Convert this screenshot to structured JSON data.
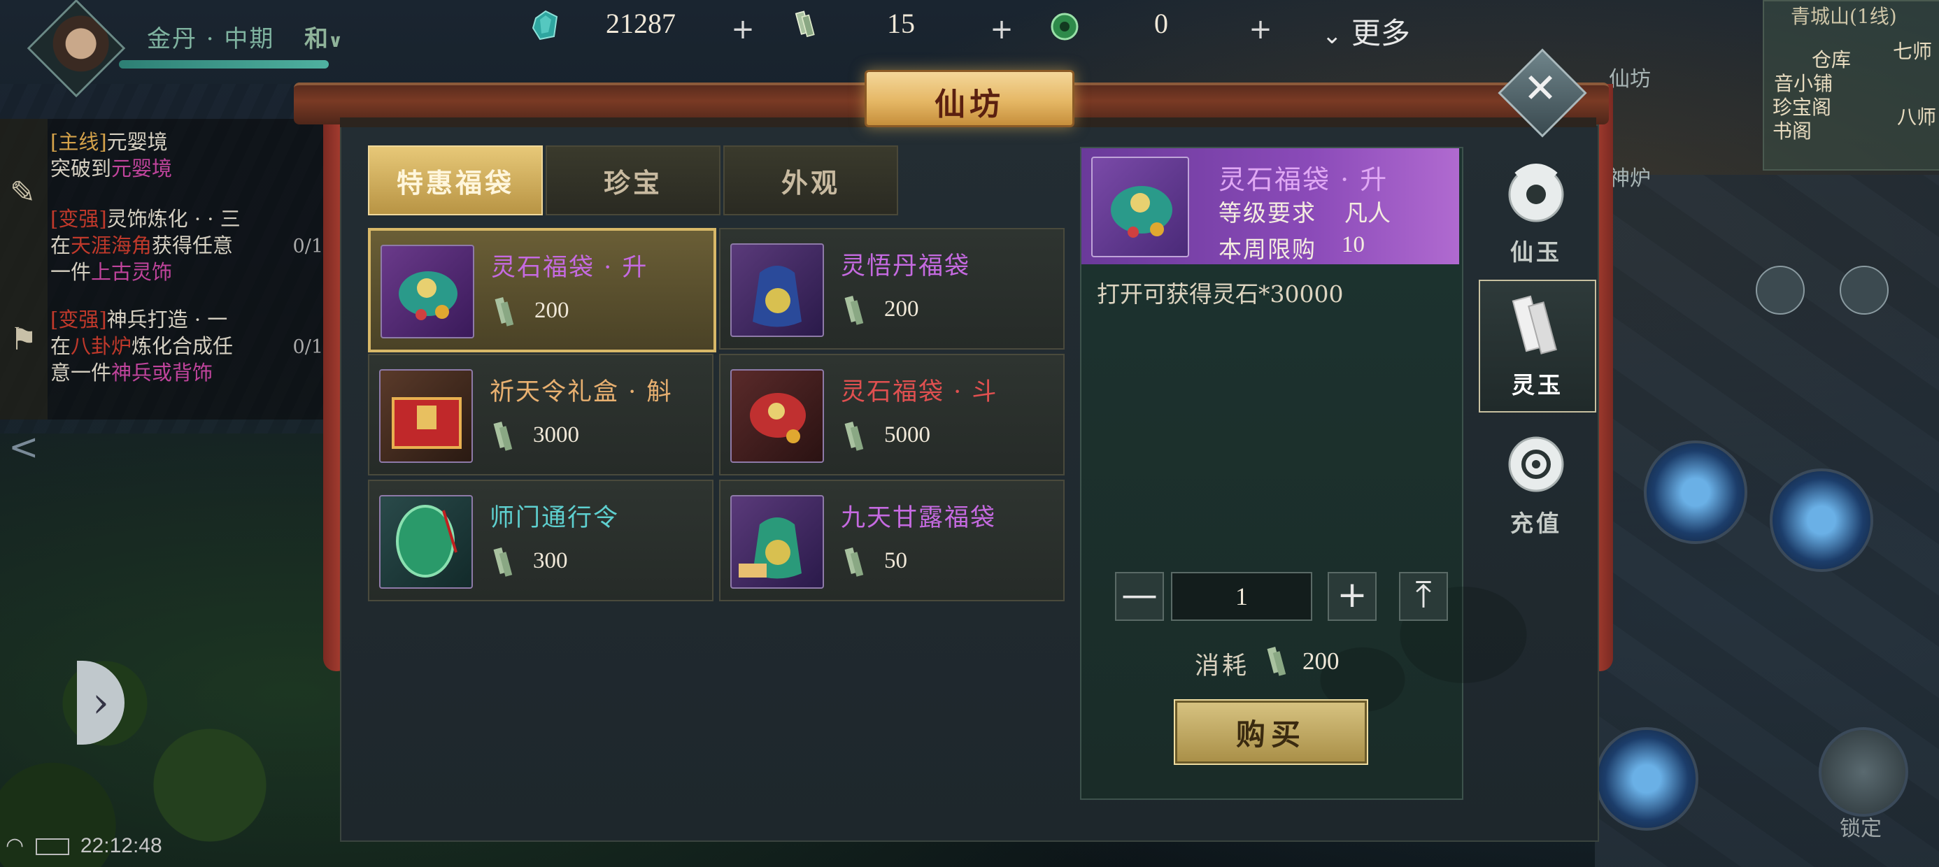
{
  "top_bar": {
    "realm": "金丹 · 中期",
    "mode": "和",
    "currencies": [
      {
        "icon": "spirit-crystal-icon",
        "value": "21287"
      },
      {
        "icon": "spirit-jade-icon",
        "value": "15"
      },
      {
        "icon": "jade-ring-icon",
        "value": "0"
      }
    ],
    "plus": "+",
    "more_label": "更多"
  },
  "quests": [
    {
      "tag": "[主线]",
      "title": "元婴境",
      "line2a": "突破到",
      "line2b": "元婴境"
    },
    {
      "tag": "[变强]",
      "title": "灵饰炼化 · · 三",
      "line2a": "在",
      "place": "天涯海角",
      "line2b": "获得任意",
      "line3a": "一件",
      "line3b": "上古灵饰",
      "progress": "0/1"
    },
    {
      "tag": "[变强]",
      "title": "神兵打造 · 一",
      "line2a": "在",
      "place": "八卦炉",
      "line2b": "炼化合成任",
      "line3a": "意一件",
      "line3b": "神兵或背饰",
      "progress": "0/1"
    }
  ],
  "status": {
    "time": "22:12:48"
  },
  "minimap": {
    "title": "青城山(1线)",
    "labels": [
      "仓库",
      "音小铺",
      "珍宝阁",
      "书阁",
      "七师",
      "八师"
    ]
  },
  "side_labels": {
    "xianfang": "仙坊",
    "forge": "神炉",
    "lock": "锁定"
  },
  "modal": {
    "title": "仙坊",
    "close": "✕",
    "tabs": [
      "特惠福袋",
      "珍宝",
      "外观"
    ],
    "active_tab": 0,
    "items": [
      {
        "name": "灵石福袋 · 升",
        "price": "200",
        "color": "purple",
        "image": "jade-lucky-bag"
      },
      {
        "name": "灵悟丹福袋",
        "price": "200",
        "color": "purple",
        "image": "blue-lucky-bag"
      },
      {
        "name": "祈天令礼盒 · 斛",
        "price": "3000",
        "color": "orange",
        "image": "red-gift-box"
      },
      {
        "name": "灵石福袋 · 斗",
        "price": "5000",
        "color": "red",
        "image": "red-lucky-bag"
      },
      {
        "name": "师门通行令",
        "price": "300",
        "color": "cyan",
        "image": "jade-token"
      },
      {
        "name": "九天甘露福袋",
        "price": "50",
        "color": "purple",
        "image": "green-lucky-bag"
      }
    ],
    "selected_index": 0,
    "detail": {
      "name": "灵石福袋 · 升",
      "level_label": "等级要求",
      "level_value": "凡人",
      "limit_label": "本周限购",
      "limit_value": "10",
      "description": "打开可获得灵石*30000",
      "quantity": "1",
      "minus": "—",
      "plus": "+",
      "max": "⤒",
      "cost_label": "消耗",
      "cost_value": "200",
      "buy_label": "购买"
    },
    "categories": [
      {
        "label": "仙玉",
        "icon": "xianyu-icon"
      },
      {
        "label": "灵玉",
        "icon": "lingyu-icon"
      },
      {
        "label": "充值",
        "icon": "recharge-icon"
      }
    ],
    "active_category": 1
  },
  "colors": {
    "purple": "#c56ae0",
    "orange": "#e8b070",
    "red": "#e05050",
    "cyan": "#5ed0d0",
    "gold": "#d8b868"
  }
}
